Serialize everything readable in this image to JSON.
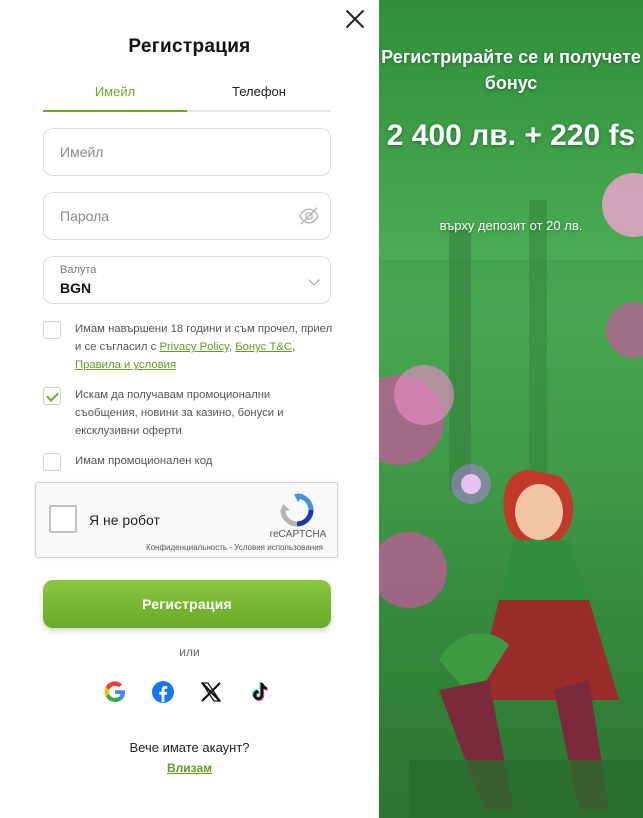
{
  "modal": {
    "title": "Регистрация",
    "tabs": [
      {
        "label": "Имейл",
        "active": true
      },
      {
        "label": "Телефон",
        "active": false
      }
    ]
  },
  "form": {
    "email_placeholder": "Имейл",
    "email_value": "",
    "password_placeholder": "Парола",
    "password_value": "",
    "currency_label": "Валута",
    "currency_value": "BGN"
  },
  "checks": {
    "terms_text": "Имам навършени 18 години и съм прочел, приел и се съгласил с",
    "privacy_link": "Privacy Policy",
    "bonus_link": "Бонус T&C",
    "rules_link": "Правила и условия",
    "terms_checked": false,
    "promo_text": "Искам да получавам промоционални съобщения, новини за казино, бонуси и ексклузивни оферти",
    "promo_checked": true,
    "promo_code_text": "Имам промоционален код",
    "promo_code_checked": false
  },
  "recaptcha": {
    "label": "Я не робот",
    "brand": "reCAPTCHA",
    "links": "Конфиденциальность - Условия использования"
  },
  "actions": {
    "register_label": "Регистрация",
    "or_label": "или",
    "social": [
      "google-icon",
      "facebook-icon",
      "x-icon",
      "tiktok-icon"
    ],
    "have_account": "Вече имате акаунт?",
    "login_label": "Влизам"
  },
  "promo": {
    "line1": "Регистрирайте се и получете бонус",
    "line2": "2 400 лв. + 220 fs",
    "line3": "върху депозит от 20 лв."
  },
  "colors": {
    "accent": "#6aab2a",
    "button_top": "#8cc63f",
    "button_bottom": "#6aa92a",
    "link": "#5e9c22"
  }
}
